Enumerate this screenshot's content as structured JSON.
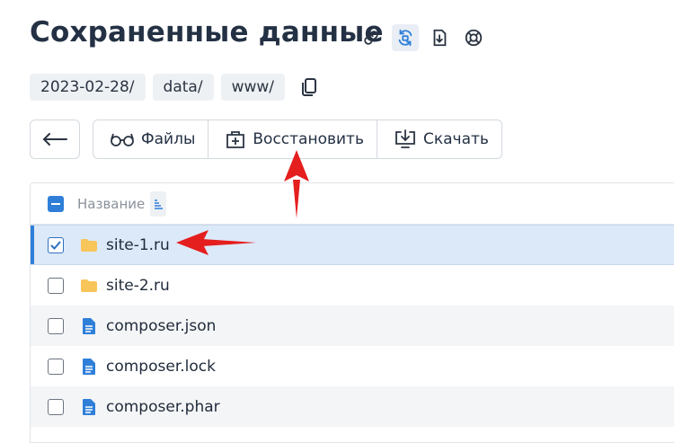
{
  "page": {
    "title": "Сохраненные данные"
  },
  "title_icons": [
    "link-icon",
    "refresh-icon",
    "download-file-icon",
    "lifebuoy-icon"
  ],
  "breadcrumbs": [
    "2023-02-28/",
    "data/",
    "www/"
  ],
  "toolbar": {
    "files_label": "Файлы",
    "restore_label": "Восстановить",
    "download_label": "Скачать"
  },
  "table": {
    "header_name": "Название",
    "rows": [
      {
        "name": "site-1.ru",
        "type": "folder",
        "checked": true
      },
      {
        "name": "site-2.ru",
        "type": "folder",
        "checked": false
      },
      {
        "name": "composer.json",
        "type": "file",
        "checked": false
      },
      {
        "name": "composer.lock",
        "type": "file",
        "checked": false
      },
      {
        "name": "composer.phar",
        "type": "file",
        "checked": false
      }
    ]
  },
  "colors": {
    "accent": "#2f7fd9",
    "selected_row": "#dce9f8",
    "annotation_arrow": "#e51e1e",
    "folder": "#f7c55a"
  }
}
